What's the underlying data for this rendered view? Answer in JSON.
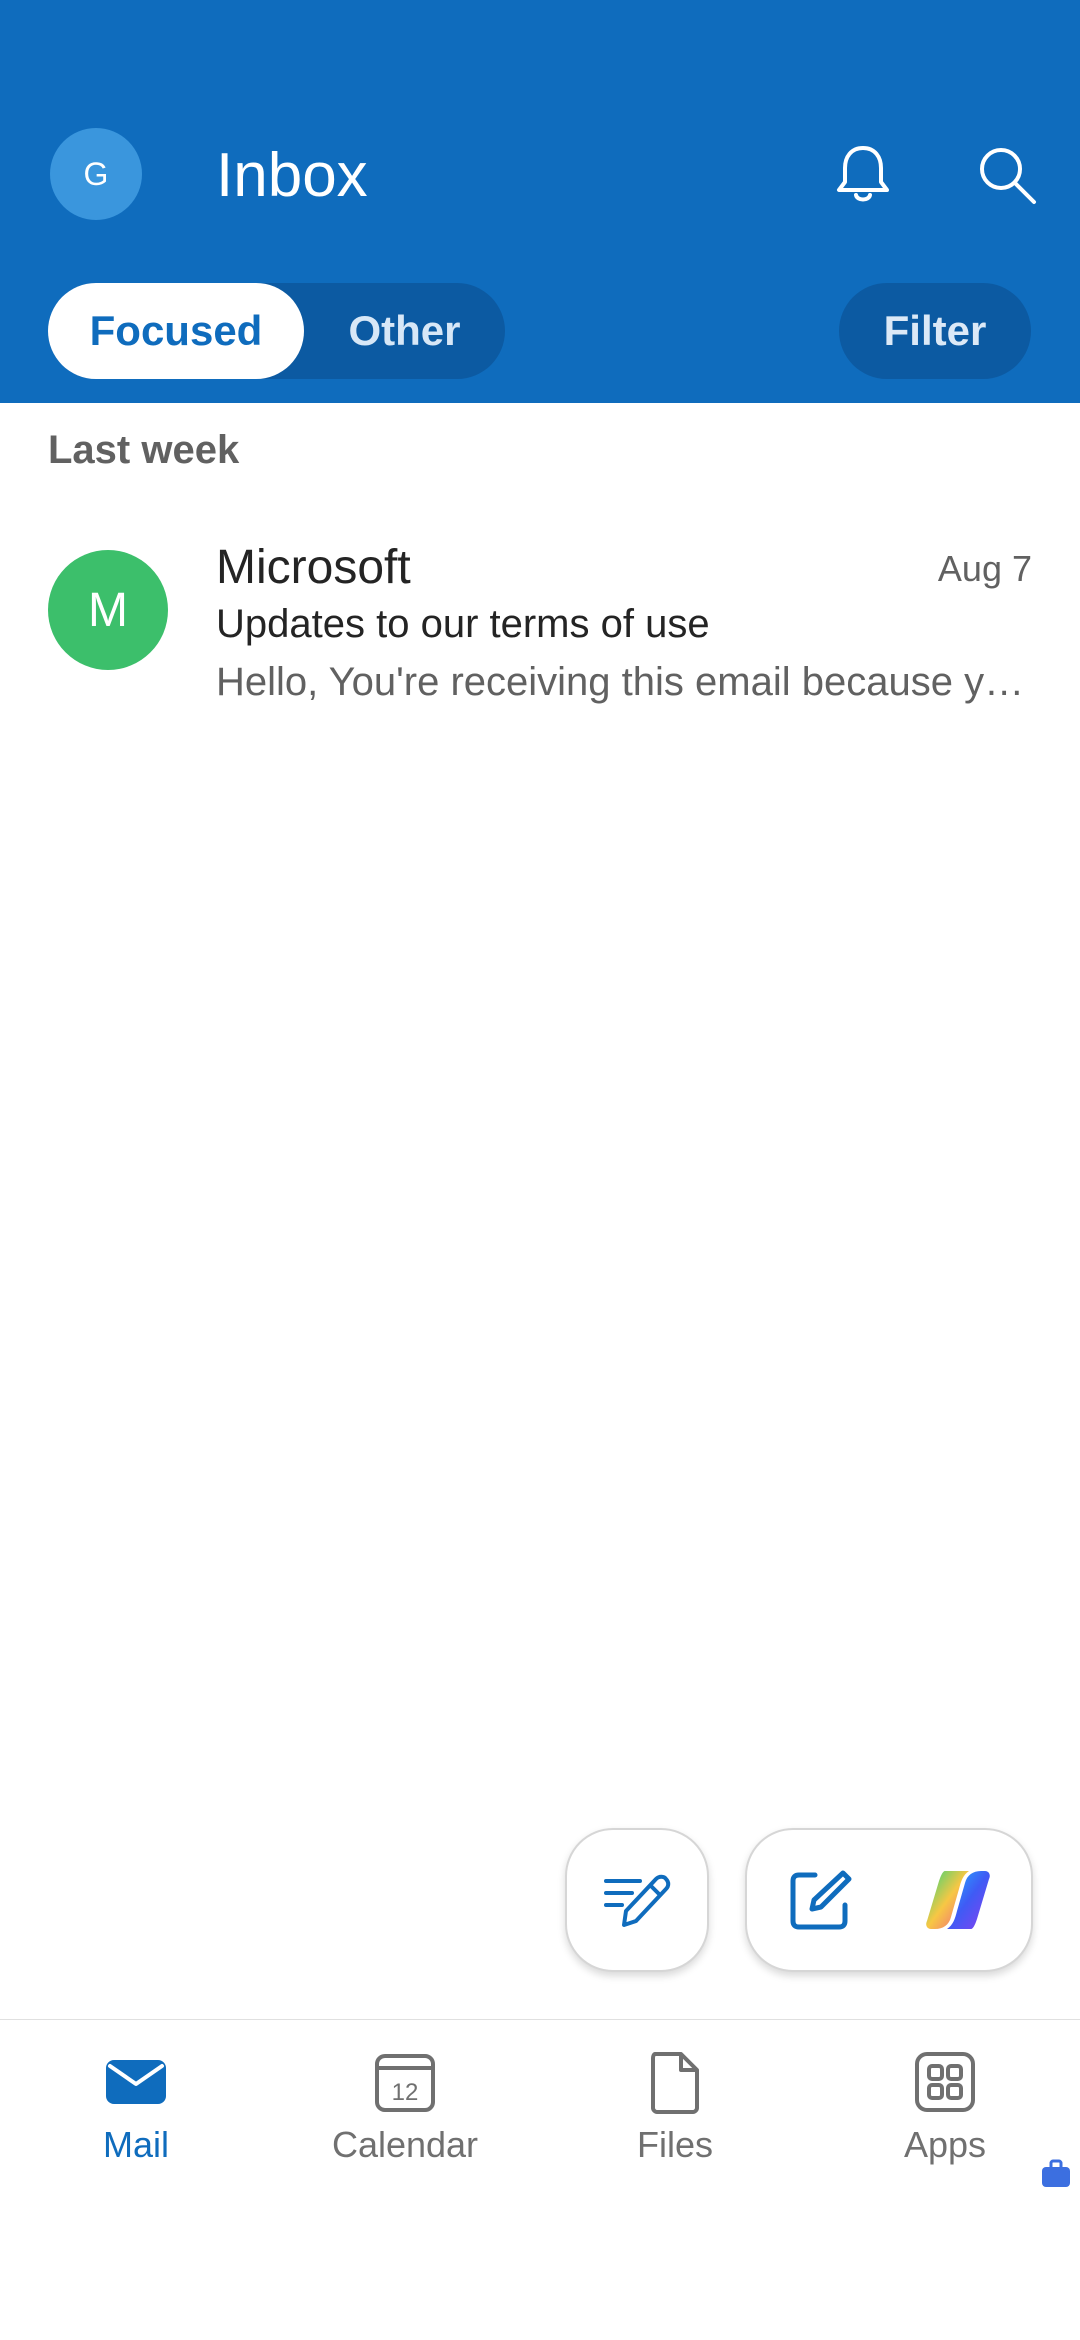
{
  "header": {
    "avatar_initial": "G",
    "title": "Inbox",
    "tabs": {
      "focused": "Focused",
      "other": "Other"
    },
    "filter_label": "Filter",
    "bell_icon": "bell-icon",
    "search_icon": "search-icon"
  },
  "section": {
    "label": "Last week"
  },
  "emails": [
    {
      "avatar_initial": "M",
      "sender": "Microsoft",
      "date": "Aug 7",
      "subject": "Updates to our terms of use",
      "preview": "Hello, You're receiving this email because you use Microsoft services"
    }
  ],
  "nav": {
    "items": [
      {
        "label": "Mail",
        "icon": "mail-icon",
        "active": true
      },
      {
        "label": "Calendar",
        "icon": "calendar-icon",
        "active": false,
        "day": "12"
      },
      {
        "label": "Files",
        "icon": "file-icon",
        "active": false
      },
      {
        "label": "Apps",
        "icon": "apps-icon",
        "active": false
      }
    ]
  },
  "colors": {
    "brand": "#0f6cbd",
    "segment_bg": "#0c5aa2",
    "avatar_g": "#3a96dd",
    "avatar_m": "#3cbf6b"
  }
}
